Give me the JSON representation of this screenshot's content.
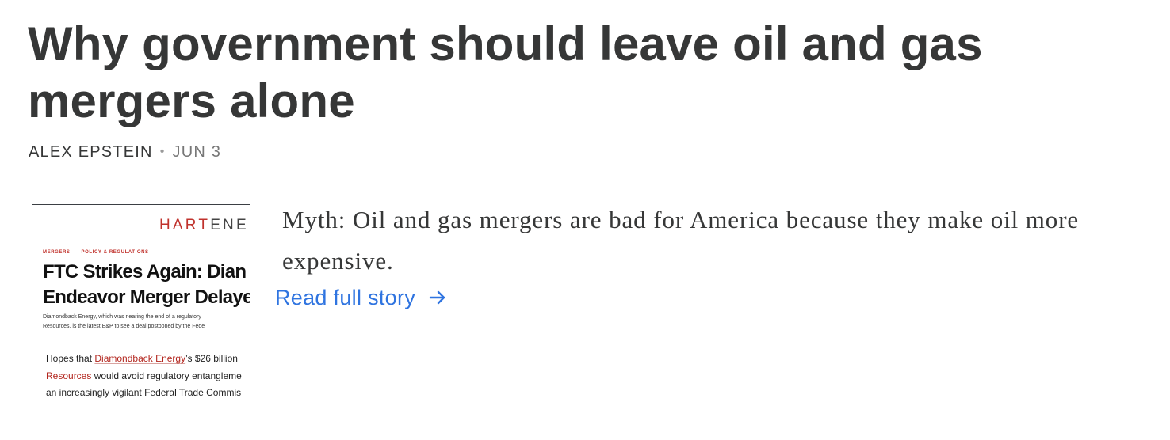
{
  "post": {
    "title": "Why government should leave oil and gas mergers alone",
    "author": "ALEX EPSTEIN",
    "separator": "•",
    "date": "JUN 3",
    "summary": "Myth: Oil and gas mergers are bad for America because they make oil more expensive.",
    "read_more_label": "Read full story",
    "link_color": "#2f74e0"
  },
  "thumbnail": {
    "brand_part1": "HART",
    "brand_part2": "ENER",
    "brand_color": "#c0322c",
    "tag1": "MERGERS",
    "tag2": "POLICY & REGULATIONS",
    "headline_line1": "FTC Strikes Again: Dian",
    "headline_line2": "Endeavor Merger Delaye",
    "dek_line1": "Diamondback Energy, which was nearing the end of a regulatory",
    "dek_line2": "Resources, is the latest E&P to see a deal postponed by the Fede",
    "excerpt_prefix": "Hopes that ",
    "excerpt_link1": "Diamondback Energy",
    "excerpt_suffix1": "’s $26 billion",
    "excerpt_link2": "Resources",
    "excerpt_suffix2": " would avoid regulatory entangleme",
    "excerpt_line3": "an increasingly vigilant Federal Trade Commis"
  }
}
